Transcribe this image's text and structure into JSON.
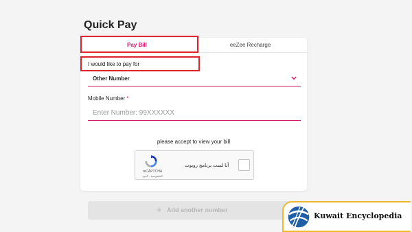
{
  "page": {
    "title": "Quick Pay"
  },
  "tabs": [
    {
      "label": "Pay Bill",
      "active": true
    },
    {
      "label": "eeZee Recharge",
      "active": false
    }
  ],
  "form": {
    "pay_label": "I would like to pay for",
    "pay_for_value": "Other Number",
    "mobile_label": "Mobile Number",
    "required_mark": "*",
    "mobile_placeholder": "Enter Number: 99XXXXXX",
    "mobile_value": ""
  },
  "captcha": {
    "prompt": "please accept to view your bill",
    "brand": "reCAPTCHA",
    "terms": "الخصوصية - البنود",
    "checkbox_text": "أنا لست برنامج روبوت",
    "checked": false
  },
  "add_number": {
    "plus": "+",
    "label": "Add another number"
  },
  "watermark": {
    "text": "Kuwait Encyclopedia"
  },
  "colors": {
    "accent": "#d1166e",
    "highlight": "#e0242c",
    "watermark_border": "#f0b929"
  },
  "icons": {
    "select_toggle": "chevron-down-icon",
    "captcha": "recaptcha-icon",
    "watermark": "globe-logo-icon"
  }
}
